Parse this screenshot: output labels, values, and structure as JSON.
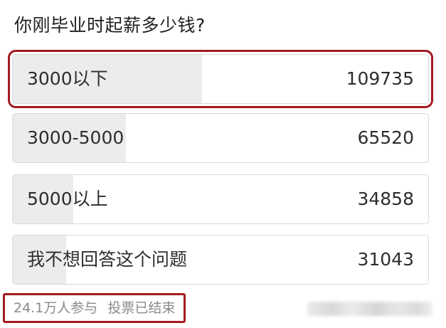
{
  "poll": {
    "question": "你刚毕业时起薪多少钱?",
    "options": [
      {
        "label": "3000以下",
        "count": "109735",
        "share": 0.455,
        "highlighted": true
      },
      {
        "label": "3000-5000",
        "count": "65520",
        "share": 0.272,
        "highlighted": false
      },
      {
        "label": "5000以上",
        "count": "34858",
        "share": 0.145,
        "highlighted": false
      },
      {
        "label": "我不想回答这个问题",
        "count": "31043",
        "share": 0.129,
        "highlighted": false
      }
    ],
    "participants": "24.1万人参与",
    "status": "投票已结束"
  },
  "colors": {
    "highlight_border": "#a21b20",
    "bar_fill": "#ececec",
    "option_border": "#d9d9d9",
    "muted_text": "#8a8a8a"
  }
}
